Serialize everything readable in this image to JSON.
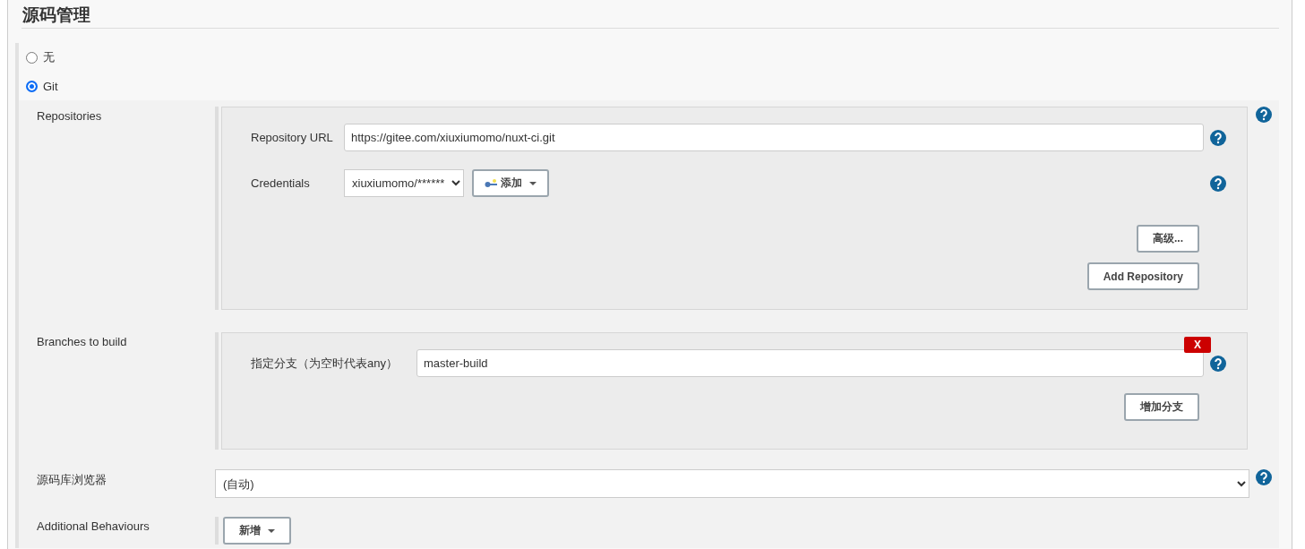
{
  "section_title": "源码管理",
  "scm_options": [
    {
      "label": "无",
      "selected": false
    },
    {
      "label": "Git",
      "selected": true
    }
  ],
  "repositories": {
    "label": "Repositories",
    "url": {
      "label": "Repository URL",
      "value": "https://gitee.com/xiuxiumomo/nuxt-ci.git"
    },
    "credentials": {
      "label": "Credentials",
      "value": "xiuxiumomo/******",
      "add_button": "添加"
    },
    "buttons": [
      "高级...",
      "Add Repository"
    ]
  },
  "branches": {
    "label": "Branches to build",
    "specifier": {
      "label": "指定分支（为空时代表any）",
      "value": "master-build",
      "delete_button": "X"
    },
    "add_button": "增加分支"
  },
  "browser": {
    "label": "源码库浏览器",
    "value": "(自动)"
  },
  "additional": {
    "label": "Additional Behaviours",
    "add_button": "新增"
  }
}
